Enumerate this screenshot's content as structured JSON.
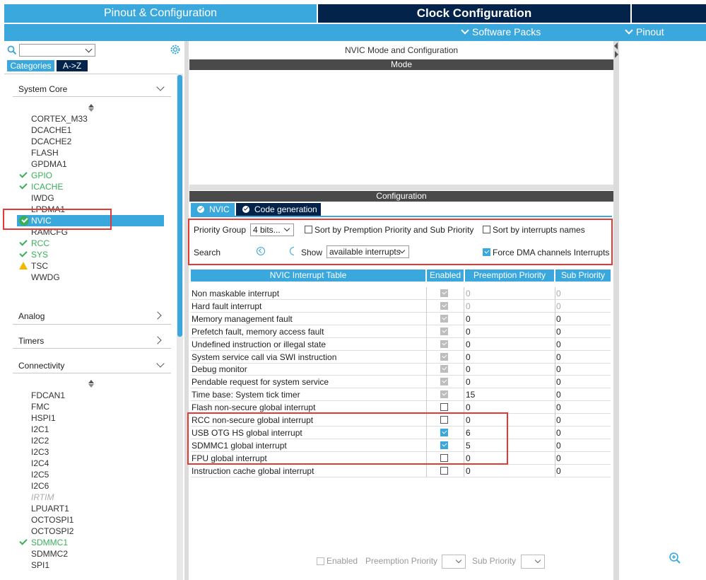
{
  "top_tabs": {
    "pinout": "Pinout & Configuration",
    "clock": "Clock Configuration"
  },
  "subbar": {
    "software_packs": "Software Packs",
    "pinout": "Pinout"
  },
  "left": {
    "tab_categories": "Categories",
    "tab_az": "A->Z",
    "sections": {
      "system_core": "System Core",
      "analog": "Analog",
      "timers": "Timers",
      "connectivity": "Connectivity"
    },
    "system_core_items": [
      "CORTEX_M33",
      "DCACHE1",
      "DCACHE2",
      "FLASH",
      "GPDMA1",
      "GPIO",
      "ICACHE",
      "IWDG",
      "LPDMA1",
      "NVIC",
      "RAMCFG",
      "RCC",
      "SYS",
      "TSC",
      "WWDG"
    ],
    "connectivity_items": [
      "FDCAN1",
      "FMC",
      "HSPI1",
      "I2C1",
      "I2C2",
      "I2C3",
      "I2C4",
      "I2C5",
      "I2C6",
      "IRTIM",
      "LPUART1",
      "OCTOSPI1",
      "OCTOSPI2",
      "SDMMC1",
      "SDMMC2",
      "SPI1"
    ]
  },
  "middle": {
    "title": "NVIC Mode and Configuration",
    "mode": "Mode",
    "configuration": "Configuration",
    "tab_nvic": "NVIC",
    "tab_codegen": "Code generation",
    "priority_group_label": "Priority Group",
    "priority_group_value": "4 bits...",
    "sort_premption": "Sort by Premption Priority and Sub Priority",
    "sort_names": "Sort by interrupts names",
    "search_label": "Search",
    "show_label": "Show",
    "show_value": "available interrupts",
    "force_dma": "Force DMA channels Interrupts",
    "table_headers": [
      "NVIC Interrupt Table",
      "Enabled",
      "Preemption Priority",
      "Sub Priority"
    ],
    "rows": [
      {
        "name": "Non maskable interrupt",
        "enabled": "locked",
        "pp": "0",
        "sp": "0",
        "grey": true
      },
      {
        "name": "Hard fault interrupt",
        "enabled": "locked",
        "pp": "0",
        "sp": "0",
        "grey": true
      },
      {
        "name": "Memory management fault",
        "enabled": "locked",
        "pp": "0",
        "sp": "0",
        "grey": false
      },
      {
        "name": "Prefetch fault, memory access fault",
        "enabled": "locked",
        "pp": "0",
        "sp": "0",
        "grey": false
      },
      {
        "name": "Undefined instruction or illegal state",
        "enabled": "locked",
        "pp": "0",
        "sp": "0",
        "grey": false
      },
      {
        "name": "System service call via SWI instruction",
        "enabled": "locked",
        "pp": "0",
        "sp": "0",
        "grey": false
      },
      {
        "name": "Debug monitor",
        "enabled": "locked",
        "pp": "0",
        "sp": "0",
        "grey": false
      },
      {
        "name": "Pendable request for system service",
        "enabled": "locked",
        "pp": "0",
        "sp": "0",
        "grey": false
      },
      {
        "name": "Time base: System tick timer",
        "enabled": "locked",
        "pp": "15",
        "sp": "0",
        "grey": false
      },
      {
        "name": "Flash non-secure global interrupt",
        "enabled": "off",
        "pp": "0",
        "sp": "0",
        "grey": false
      },
      {
        "name": "RCC non-secure global interrupt",
        "enabled": "off",
        "pp": "0",
        "sp": "0",
        "grey": false
      },
      {
        "name": "USB OTG HS global interrupt",
        "enabled": "on",
        "pp": "6",
        "sp": "0",
        "grey": false
      },
      {
        "name": "SDMMC1 global interrupt",
        "enabled": "on",
        "pp": "5",
        "sp": "0",
        "grey": false
      },
      {
        "name": "FPU global interrupt",
        "enabled": "off",
        "pp": "0",
        "sp": "0",
        "grey": false
      },
      {
        "name": "Instruction cache global interrupt",
        "enabled": "off",
        "pp": "0",
        "sp": "0",
        "grey": false
      }
    ],
    "bottom_enabled": "Enabled",
    "bottom_pp": "Preemption Priority",
    "bottom_sp": "Sub Priority"
  },
  "colors": {
    "accent": "#3aa8dc",
    "dark": "#03234b",
    "green": "#3aaf5a",
    "highlight": "#e53935"
  }
}
